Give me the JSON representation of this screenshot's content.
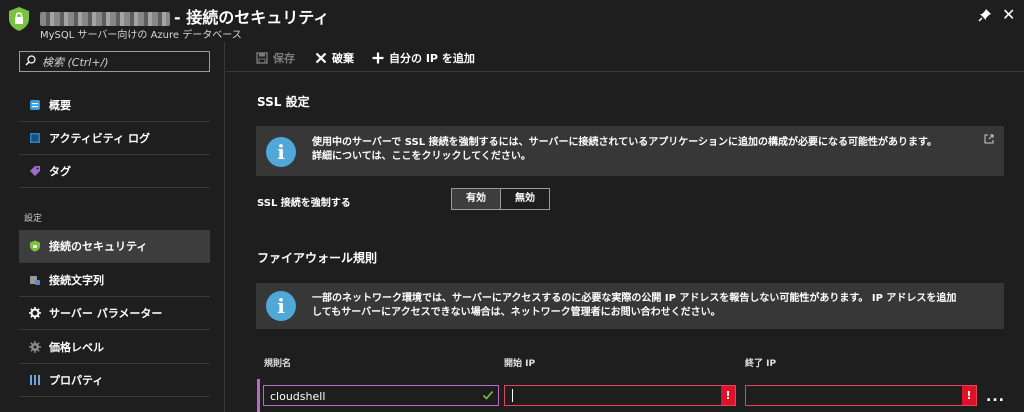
{
  "header": {
    "title": "- 接続のセキュリティ",
    "subtitle": "MySQL サーバー向けの Azure データベース"
  },
  "sidebar": {
    "search_placeholder": "検索 (Ctrl+/)",
    "section_settings": "設定",
    "items": [
      {
        "label": "概要",
        "icon": "overview-icon"
      },
      {
        "label": "アクティビティ ログ",
        "icon": "activity-log-icon"
      },
      {
        "label": "タグ",
        "icon": "tag-icon"
      },
      {
        "label": "接続のセキュリティ",
        "icon": "shield-icon",
        "active": true
      },
      {
        "label": "接続文字列",
        "icon": "connection-string-icon"
      },
      {
        "label": "サーバー パラメーター",
        "icon": "gear-icon"
      },
      {
        "label": "価格レベル",
        "icon": "pricing-icon"
      },
      {
        "label": "プロパティ",
        "icon": "properties-icon"
      }
    ]
  },
  "toolbar": {
    "save_label": "保存",
    "discard_label": "破棄",
    "add_ip_label": "自分の IP を追加"
  },
  "ssl": {
    "heading": "SSL 設定",
    "info_line1": "使用中のサーバーで SSL 接続を強制するには、サーバーに接続されているアプリケーションに追加の構成が必要になる可能性があります。",
    "info_line2": "詳細については、ここをクリックしてください。",
    "enforce_label": "SSL 接続を強制する",
    "option_on": "有効",
    "option_off": "無効",
    "selected": "有効"
  },
  "firewall": {
    "heading": "ファイアウォール規則",
    "info_line1": "一部のネットワーク環境では、サーバーにアクセスするのに必要な実際の公開 IP アドレスを報告しない可能性があります。 IP アドレスを追加",
    "info_line2": "してもサーバーにアクセスできない場合は、ネットワーク管理者にお問い合わせください。",
    "columns": {
      "rule_name": "規則名",
      "start_ip": "開始 IP",
      "end_ip": "終了 IP"
    },
    "rows": [
      {
        "rule_name": "cloudshell",
        "start_ip": "",
        "end_ip": "",
        "error_mark": "!"
      }
    ],
    "more_label": "..."
  },
  "colors": {
    "background": "#1e1e1e",
    "info_panel": "#373737",
    "info_icon": "#4fa8d8",
    "error": "#e0122a",
    "row_accent": "#b26ec2"
  }
}
